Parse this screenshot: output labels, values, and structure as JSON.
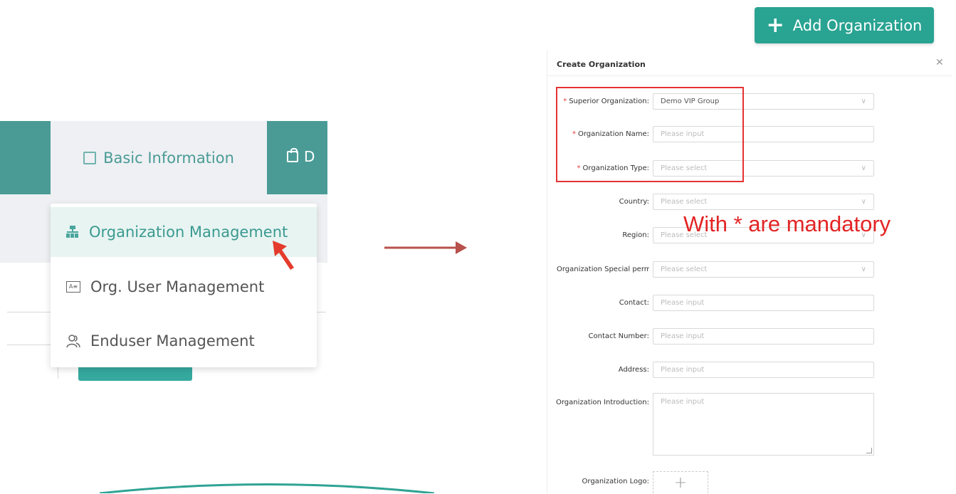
{
  "left_panel": {
    "nav_tab_basic": "Basic Information",
    "nav_tab_next_partial": "D",
    "menu_items": [
      {
        "label": "Organization Management",
        "icon": "org-tree-icon",
        "active": true
      },
      {
        "label": "Org. User Management",
        "icon": "id-card-icon",
        "active": false
      },
      {
        "label": "Enduser Management",
        "icon": "users-icon",
        "active": false
      }
    ]
  },
  "right_panel": {
    "add_button_label": "Add Organization",
    "modal_title": "Create Organization",
    "fields": [
      {
        "label": "Superior Organization",
        "required": true,
        "type": "select",
        "value": "Demo VIP Group"
      },
      {
        "label": "Organization Name",
        "required": true,
        "type": "input",
        "placeholder": "Please input"
      },
      {
        "label": "Organization Type",
        "required": true,
        "type": "select",
        "placeholder": "Please select"
      },
      {
        "label": "Country",
        "required": false,
        "type": "select",
        "placeholder": "Please select"
      },
      {
        "label": "Region",
        "required": false,
        "type": "select",
        "placeholder": "Please select"
      },
      {
        "label": "Organization Special permis",
        "required": false,
        "type": "select",
        "placeholder": "Please select"
      },
      {
        "label": "Contact",
        "required": false,
        "type": "input",
        "placeholder": "Please input"
      },
      {
        "label": "Contact Number",
        "required": false,
        "type": "input",
        "placeholder": "Please input"
      },
      {
        "label": "Address",
        "required": false,
        "type": "input",
        "placeholder": "Please input"
      },
      {
        "label": "Organization Introduction",
        "required": false,
        "type": "textarea",
        "placeholder": "Please input"
      },
      {
        "label": "Organization Logo",
        "required": false,
        "type": "upload"
      }
    ],
    "annotation": "With * are mandatory"
  },
  "colors": {
    "teal": "#29a392",
    "nav": "#4a9b96",
    "annotation_red": "#e32424"
  }
}
